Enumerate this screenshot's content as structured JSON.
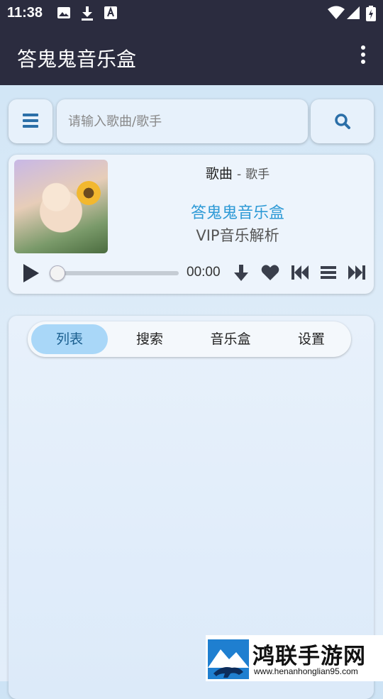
{
  "status_bar": {
    "time": "11:38",
    "icons": [
      "image-icon",
      "download-icon",
      "font-icon",
      "wifi-icon",
      "signal-icon",
      "battery-icon"
    ]
  },
  "app_bar": {
    "title": "答鬼鬼音乐盒",
    "menu_icon": "more-vert-icon"
  },
  "search": {
    "placeholder": "请输入歌曲/歌手",
    "value": "",
    "menu_icon": "hamburger-icon",
    "search_icon": "search-icon"
  },
  "player": {
    "song": "歌曲",
    "separator": "-",
    "artist": "歌手",
    "brand": "答鬼鬼音乐盒",
    "subtitle": "VIP音乐解析",
    "time": "00:00",
    "progress": 0,
    "controls": [
      "play-icon",
      "download-icon",
      "heart-icon",
      "previous-icon",
      "playlist-icon",
      "next-icon"
    ]
  },
  "tabs": [
    {
      "label": "列表",
      "active": true
    },
    {
      "label": "搜索",
      "active": false
    },
    {
      "label": "音乐盒",
      "active": false
    },
    {
      "label": "设置",
      "active": false
    }
  ],
  "watermark": {
    "title": "鸿联手游网",
    "url": "www.henanhonglian95.com"
  },
  "colors": {
    "app_bar": "#2b2c3f",
    "accent": "#2e9ad6",
    "icon_blue": "#2b6fa8",
    "tab_active": "#a9d7f8"
  }
}
